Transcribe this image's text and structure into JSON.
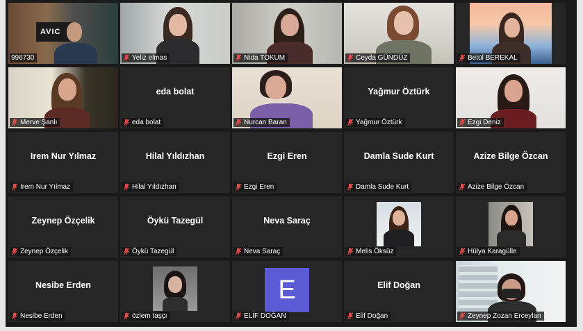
{
  "participants": [
    {
      "name": "996730",
      "display": "996730",
      "kind": "video",
      "active": true
    },
    {
      "name": "Yeliz elmas",
      "kind": "video"
    },
    {
      "name": "Nida TOKUM",
      "kind": "video"
    },
    {
      "name": "Ceyda GÜNDÜZ",
      "kind": "video"
    },
    {
      "name": "Betül BEREKAL",
      "kind": "video"
    },
    {
      "name": "Merve Şanlı",
      "kind": "video"
    },
    {
      "name": "eda bolat",
      "kind": "name"
    },
    {
      "name": "Nurcan Baran",
      "kind": "video"
    },
    {
      "name": "Yağmur Öztürk",
      "kind": "name"
    },
    {
      "name": "Ezgi Deniz",
      "kind": "video"
    },
    {
      "name": "Irem Nur Yılmaz",
      "kind": "name"
    },
    {
      "name": "Hilal Yıldızhan",
      "kind": "name"
    },
    {
      "name": "Ezgi Eren",
      "kind": "name"
    },
    {
      "name": "Damla Sude Kurt",
      "kind": "name"
    },
    {
      "name": "Azize Bilge Özcan",
      "kind": "name"
    },
    {
      "name": "Zeynep Özçelik",
      "kind": "name"
    },
    {
      "name": "Öykü Tazegül",
      "kind": "name"
    },
    {
      "name": "Neva Saraç",
      "kind": "name"
    },
    {
      "name": "Melis Öksüz",
      "kind": "picture"
    },
    {
      "name": "Hülya Karagülle",
      "kind": "picture"
    },
    {
      "name": "Nesibe Erden",
      "kind": "name"
    },
    {
      "name": "özlem taşçı",
      "kind": "picture"
    },
    {
      "name": "ELİF DOĞAN",
      "kind": "letter",
      "letter": "E"
    },
    {
      "name": "Elif Doğan",
      "kind": "name"
    },
    {
      "name": "Zeynep Zozan Erceylan",
      "kind": "video"
    }
  ],
  "colors": {
    "background": "#1a1a1a",
    "tile": "#262626",
    "active_border": "#e9e96a",
    "muted_mic": "#e04a4a",
    "letter_avatar": "#5b5bd6"
  },
  "icons": {
    "mic": "muted-microphone-icon"
  }
}
